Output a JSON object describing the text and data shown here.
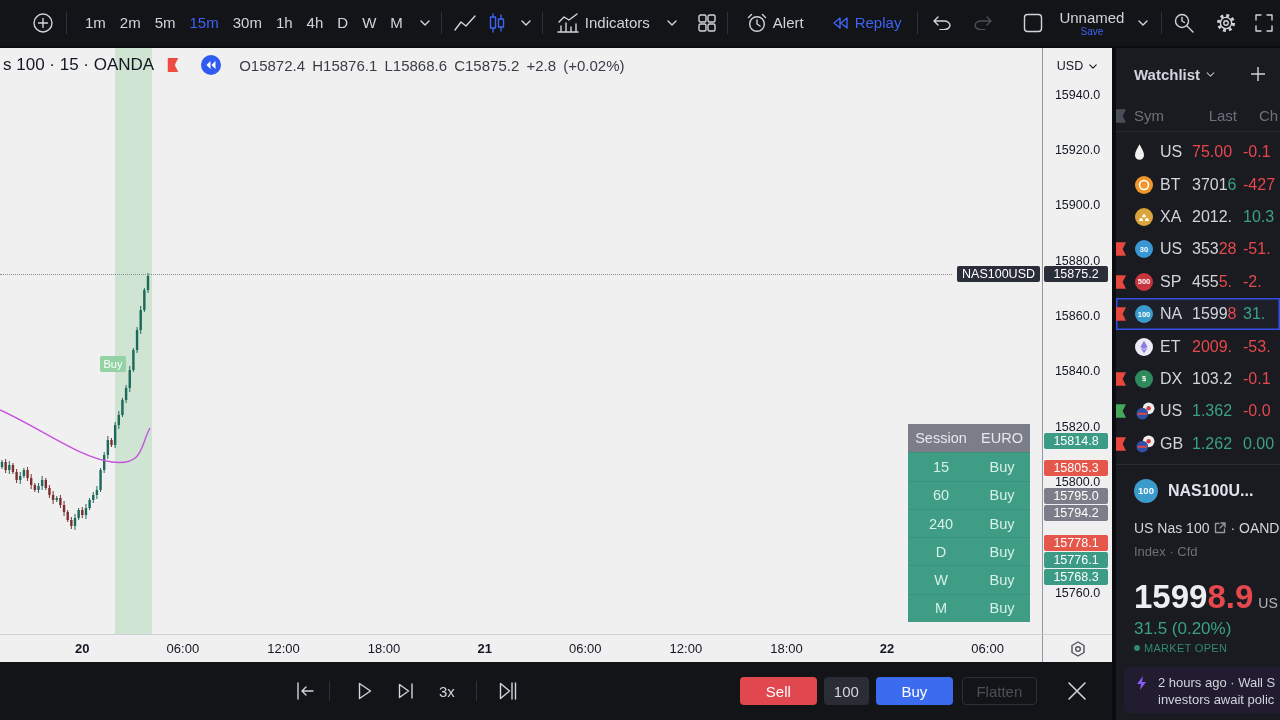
{
  "toolbar": {
    "intervals": [
      {
        "label": "1m",
        "selected": false
      },
      {
        "label": "2m",
        "selected": false
      },
      {
        "label": "5m",
        "selected": false
      },
      {
        "label": "15m",
        "selected": true
      },
      {
        "label": "30m",
        "selected": false
      },
      {
        "label": "1h",
        "selected": false
      },
      {
        "label": "4h",
        "selected": false
      },
      {
        "label": "D",
        "selected": false
      },
      {
        "label": "W",
        "selected": false
      },
      {
        "label": "M",
        "selected": false
      }
    ],
    "chart_types": [
      {
        "kind": "line",
        "selected": false
      },
      {
        "kind": "candles",
        "selected": true
      }
    ],
    "indicators": {
      "label": "Indicators"
    },
    "alert": {
      "label": "Alert"
    },
    "replay": {
      "label": "Replay",
      "on": true
    },
    "undo": {
      "disabled": false
    },
    "redo": {
      "disabled": true
    },
    "layout": {
      "name": "Unnamed",
      "action": "Save"
    }
  },
  "legend": {
    "title": "s 100 · 15 · OANDA",
    "ohlc": "O15872.4 H15876.1 L15868.6 C15875.2 +2.8 (+0.02%)"
  },
  "chart": {
    "marker": {
      "label": "Buy"
    },
    "last_price": {
      "symbol": "NAS100USD",
      "price": "15875.2"
    }
  },
  "session_table": {
    "columns": [
      "Session",
      "EURO"
    ],
    "rows": [
      {
        "timeframe": "15",
        "signal": "Buy"
      },
      {
        "timeframe": "60",
        "signal": "Buy"
      },
      {
        "timeframe": "240",
        "signal": "Buy"
      },
      {
        "timeframe": "D",
        "signal": "Buy"
      },
      {
        "timeframe": "W",
        "signal": "Buy"
      },
      {
        "timeframe": "M",
        "signal": "Buy"
      }
    ]
  },
  "price_axis": {
    "currency": "USD",
    "ticks": [
      "15940.0",
      "15920.0",
      "15900.0",
      "15880.0",
      "15860.0",
      "15840.0",
      "15820.0",
      "15800.0",
      "15760.0"
    ],
    "tags": [
      {
        "price": "15814.8",
        "color": "#3b9b85"
      },
      {
        "price": "15805.3",
        "color": "#e5564b"
      },
      {
        "price": "15795.0",
        "color": "#7b7e88"
      },
      {
        "price": "15794.2",
        "color": "#7b7e88"
      },
      {
        "price": "15778.1",
        "color": "#e5564b"
      },
      {
        "price": "15776.1",
        "color": "#3b9b85"
      },
      {
        "price": "15768.3",
        "color": "#3b9b85"
      }
    ]
  },
  "time_axis": {
    "labels": [
      {
        "text": "20",
        "kind": "day"
      },
      {
        "text": "06:00",
        "kind": "time"
      },
      {
        "text": "12:00",
        "kind": "time"
      },
      {
        "text": "18:00",
        "kind": "time"
      },
      {
        "text": "21",
        "kind": "day"
      },
      {
        "text": "06:00",
        "kind": "time"
      },
      {
        "text": "12:00",
        "kind": "time"
      },
      {
        "text": "18:00",
        "kind": "time"
      },
      {
        "text": "22",
        "kind": "day"
      },
      {
        "text": "06:00",
        "kind": "time"
      }
    ]
  },
  "replay_bar": {
    "speed": "3x"
  },
  "trade": {
    "sell": "Sell",
    "quantity": "100",
    "buy": "Buy",
    "flatten": {
      "label": "Flatten",
      "disabled": true
    }
  },
  "watchlist": {
    "title": "Watchlist",
    "columns": [
      "Sym",
      "Last",
      "Ch"
    ],
    "rows": [
      {
        "selected": false,
        "icon": {
          "kind": "drop"
        },
        "symbol": "US",
        "last_tick": "75.00",
        "tick_up": false,
        "change": "-0.1",
        "up": false
      },
      {
        "selected": false,
        "icon": {
          "kind": "coin",
          "color": "#f0962a"
        },
        "symbol": "BT",
        "last": "3701",
        "last_tick": "6",
        "tick_up": true,
        "change": "-427",
        "up": false
      },
      {
        "selected": false,
        "icon": {
          "kind": "ingots",
          "color": "#d9a53c"
        },
        "symbol": "XA",
        "last": "2012.",
        "change": "10.3",
        "up": true
      },
      {
        "selected": false,
        "flag": {
          "color": "#e8473e"
        },
        "icon": {
          "kind": "badge",
          "text": "30",
          "color": "#3b97d3"
        },
        "symbol": "US",
        "last": "353",
        "last_tick": "28",
        "tick_up": false,
        "change": "-51.",
        "up": false
      },
      {
        "selected": false,
        "flag": {
          "color": "#e8473e"
        },
        "icon": {
          "kind": "badge",
          "text": "500",
          "color": "#c8343e"
        },
        "symbol": "SP",
        "last": "455",
        "last_tick": "5.",
        "tick_up": false,
        "change": "-2.",
        "up": false
      },
      {
        "selected": true,
        "flag": {
          "color": "#e8473e"
        },
        "icon": {
          "kind": "badge",
          "text": "100",
          "color": "#3a9bcc"
        },
        "symbol": "NA",
        "last": "1599",
        "last_tick": "8",
        "tick_up": false,
        "change": "31.",
        "up": true
      },
      {
        "selected": false,
        "icon": {
          "kind": "diamond"
        },
        "symbol": "ET",
        "last_tick": "2009.",
        "tick_up": false,
        "change": "-53.",
        "up": false
      },
      {
        "selected": false,
        "flag": {
          "color": "#e8473e"
        },
        "icon": {
          "kind": "badge",
          "text": "$",
          "color": "#2f8a5e"
        },
        "symbol": "DX",
        "last": "103.2",
        "change": "-0.1",
        "up": false
      },
      {
        "selected": false,
        "flag": {
          "color": "#43a85a"
        },
        "icon": {
          "kind": "flag-pair"
        },
        "symbol": "US",
        "last_tick": "1.362",
        "tick_up": true,
        "change": "-0.0",
        "up": false
      },
      {
        "selected": false,
        "flag": {
          "color": "#e8473e"
        },
        "icon": {
          "kind": "flag-pair"
        },
        "symbol": "GB",
        "last_tick": "1.262",
        "tick_up": true,
        "change": "0.00",
        "up": true
      }
    ]
  },
  "detail": {
    "badge": "100",
    "symbol": "NAS100U...",
    "name": "US Nas 100",
    "exchange": "· OAND",
    "type": "Index · Cfd",
    "price": "1599",
    "price_tick": "8.9",
    "tick_up": false,
    "currency": "US",
    "change": "31.5 (0.20%)",
    "up": true,
    "status": {
      "label": "MARKET OPEN",
      "open": true
    },
    "news": {
      "lines": [
        "2 hours ago · Wall S",
        "investors await polic"
      ]
    }
  }
}
